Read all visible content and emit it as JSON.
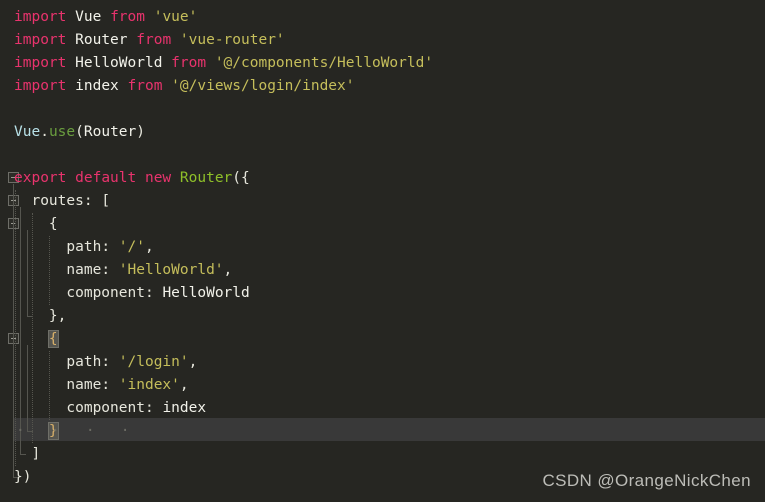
{
  "editor": {
    "background": "#262622",
    "current_line_background": "#393939",
    "foreground": "#e6e6dc",
    "font_size_px": 14.5,
    "line_height_px": 23,
    "language": "JavaScript",
    "colors": {
      "keyword": "#e8336d",
      "string": "#c5be5b",
      "function": "#6a9e3f",
      "class": "#8fc029",
      "identifier": "#f2f2ea",
      "indent_guide": "#56564f",
      "fold_marker": "#6e6e68",
      "bracket_match": "#555550"
    },
    "lines": [
      {
        "n": 1,
        "indent": 0,
        "tokens": [
          {
            "t": "import",
            "c": "kw"
          },
          {
            "t": " ",
            "c": "punc"
          },
          {
            "t": "Vue",
            "c": "ident"
          },
          {
            "t": " ",
            "c": "punc"
          },
          {
            "t": "from",
            "c": "kw"
          },
          {
            "t": " ",
            "c": "punc"
          },
          {
            "t": "'vue'",
            "c": "str"
          }
        ]
      },
      {
        "n": 2,
        "indent": 0,
        "tokens": [
          {
            "t": "import",
            "c": "kw"
          },
          {
            "t": " ",
            "c": "punc"
          },
          {
            "t": "Router",
            "c": "ident"
          },
          {
            "t": " ",
            "c": "punc"
          },
          {
            "t": "from",
            "c": "kw"
          },
          {
            "t": " ",
            "c": "punc"
          },
          {
            "t": "'vue-router'",
            "c": "str"
          }
        ]
      },
      {
        "n": 3,
        "indent": 0,
        "tokens": [
          {
            "t": "import",
            "c": "kw"
          },
          {
            "t": " ",
            "c": "punc"
          },
          {
            "t": "HelloWorld",
            "c": "ident"
          },
          {
            "t": " ",
            "c": "punc"
          },
          {
            "t": "from",
            "c": "kw"
          },
          {
            "t": " ",
            "c": "punc"
          },
          {
            "t": "'@/components/HelloWorld'",
            "c": "str"
          }
        ]
      },
      {
        "n": 4,
        "indent": 0,
        "tokens": [
          {
            "t": "import",
            "c": "kw"
          },
          {
            "t": " ",
            "c": "punc"
          },
          {
            "t": "index",
            "c": "ident"
          },
          {
            "t": " ",
            "c": "punc"
          },
          {
            "t": "from",
            "c": "kw"
          },
          {
            "t": " ",
            "c": "punc"
          },
          {
            "t": "'@/views/login/index'",
            "c": "str"
          }
        ]
      },
      {
        "n": 5,
        "indent": 0,
        "tokens": []
      },
      {
        "n": 6,
        "indent": 0,
        "tokens": [
          {
            "t": "Vue",
            "c": "objname"
          },
          {
            "t": ".",
            "c": "punc"
          },
          {
            "t": "use",
            "c": "fn"
          },
          {
            "t": "(",
            "c": "punc"
          },
          {
            "t": "Router",
            "c": "ident"
          },
          {
            "t": ")",
            "c": "punc"
          }
        ]
      },
      {
        "n": 7,
        "indent": 0,
        "tokens": []
      },
      {
        "n": 8,
        "indent": 0,
        "tokens": [
          {
            "t": "export",
            "c": "kw"
          },
          {
            "t": " ",
            "c": "punc"
          },
          {
            "t": "default",
            "c": "kw"
          },
          {
            "t": " ",
            "c": "punc"
          },
          {
            "t": "new",
            "c": "kw"
          },
          {
            "t": " ",
            "c": "punc"
          },
          {
            "t": "Router",
            "c": "cls"
          },
          {
            "t": "({",
            "c": "punc"
          }
        ]
      },
      {
        "n": 9,
        "indent": 1,
        "tokens": [
          {
            "t": "routes",
            "c": "prop"
          },
          {
            "t": ": [",
            "c": "punc"
          }
        ]
      },
      {
        "n": 10,
        "indent": 2,
        "tokens": [
          {
            "t": "{",
            "c": "punc"
          }
        ]
      },
      {
        "n": 11,
        "indent": 3,
        "tokens": [
          {
            "t": "path",
            "c": "prop"
          },
          {
            "t": ": ",
            "c": "punc"
          },
          {
            "t": "'/'",
            "c": "str"
          },
          {
            "t": ",",
            "c": "punc"
          }
        ]
      },
      {
        "n": 12,
        "indent": 3,
        "tokens": [
          {
            "t": "name",
            "c": "prop"
          },
          {
            "t": ": ",
            "c": "punc"
          },
          {
            "t": "'HelloWorld'",
            "c": "str"
          },
          {
            "t": ",",
            "c": "punc"
          }
        ]
      },
      {
        "n": 13,
        "indent": 3,
        "tokens": [
          {
            "t": "component",
            "c": "prop"
          },
          {
            "t": ": ",
            "c": "punc"
          },
          {
            "t": "HelloWorld",
            "c": "ident"
          }
        ]
      },
      {
        "n": 14,
        "indent": 2,
        "tokens": [
          {
            "t": "},",
            "c": "punc"
          }
        ]
      },
      {
        "n": 15,
        "indent": 2,
        "tokens": [
          {
            "t": "{",
            "c": "brkt"
          }
        ]
      },
      {
        "n": 16,
        "indent": 3,
        "tokens": [
          {
            "t": "path",
            "c": "prop"
          },
          {
            "t": ": ",
            "c": "punc"
          },
          {
            "t": "'/login'",
            "c": "str"
          },
          {
            "t": ",",
            "c": "punc"
          }
        ]
      },
      {
        "n": 17,
        "indent": 3,
        "tokens": [
          {
            "t": "name",
            "c": "prop"
          },
          {
            "t": ": ",
            "c": "punc"
          },
          {
            "t": "'index'",
            "c": "str"
          },
          {
            "t": ",",
            "c": "punc"
          }
        ]
      },
      {
        "n": 18,
        "indent": 3,
        "tokens": [
          {
            "t": "component",
            "c": "prop"
          },
          {
            "t": ": ",
            "c": "punc"
          },
          {
            "t": "index",
            "c": "ident"
          }
        ]
      },
      {
        "n": 19,
        "indent": 2,
        "tokens": [
          {
            "t": "}",
            "c": "brkt"
          }
        ],
        "current": true,
        "whitespace_dots": "·   ·   ·   ·"
      },
      {
        "n": 20,
        "indent": 1,
        "tokens": [
          {
            "t": "]",
            "c": "punc"
          }
        ]
      },
      {
        "n": 21,
        "indent": 0,
        "tokens": [
          {
            "t": "})",
            "c": "punc"
          }
        ]
      }
    ],
    "fold_markers": [
      {
        "line": 8,
        "state": "expanded"
      },
      {
        "line": 9,
        "state": "expanded"
      },
      {
        "line": 10,
        "state": "expanded"
      },
      {
        "line": 15,
        "state": "expanded"
      }
    ]
  },
  "watermark": {
    "text": "CSDN @OrangeNickChen"
  }
}
